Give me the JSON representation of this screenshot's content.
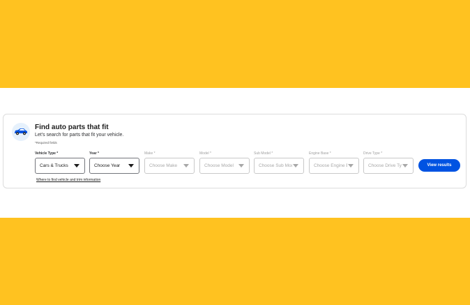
{
  "finder": {
    "title": "Find auto parts that fit",
    "subtitle": "Let's search for parts that fit your vehicle.",
    "required_note": "*Required fields",
    "icon": "car-icon",
    "fields": [
      {
        "label": "Vehicle Type *",
        "value": "Cars & Trucks",
        "disabled": false
      },
      {
        "label": "Year *",
        "value": "Choose Year",
        "disabled": false
      },
      {
        "label": "Make *",
        "value": "Choose Make",
        "disabled": true
      },
      {
        "label": "Model *",
        "value": "Choose Model",
        "disabled": true
      },
      {
        "label": "Sub Model *",
        "value": "Choose Sub Model",
        "disabled": true
      },
      {
        "label": "Engine Base *",
        "value": "Choose Engine Base",
        "disabled": true
      },
      {
        "label": "Drive Type *",
        "value": "Choose Drive Type",
        "disabled": true
      }
    ],
    "button_label": "View results",
    "help_link": "Where to find vehicle and trim information"
  },
  "colors": {
    "banner": "#ffc220",
    "primary_button": "#0053e2",
    "car_icon": "#0053e2"
  }
}
